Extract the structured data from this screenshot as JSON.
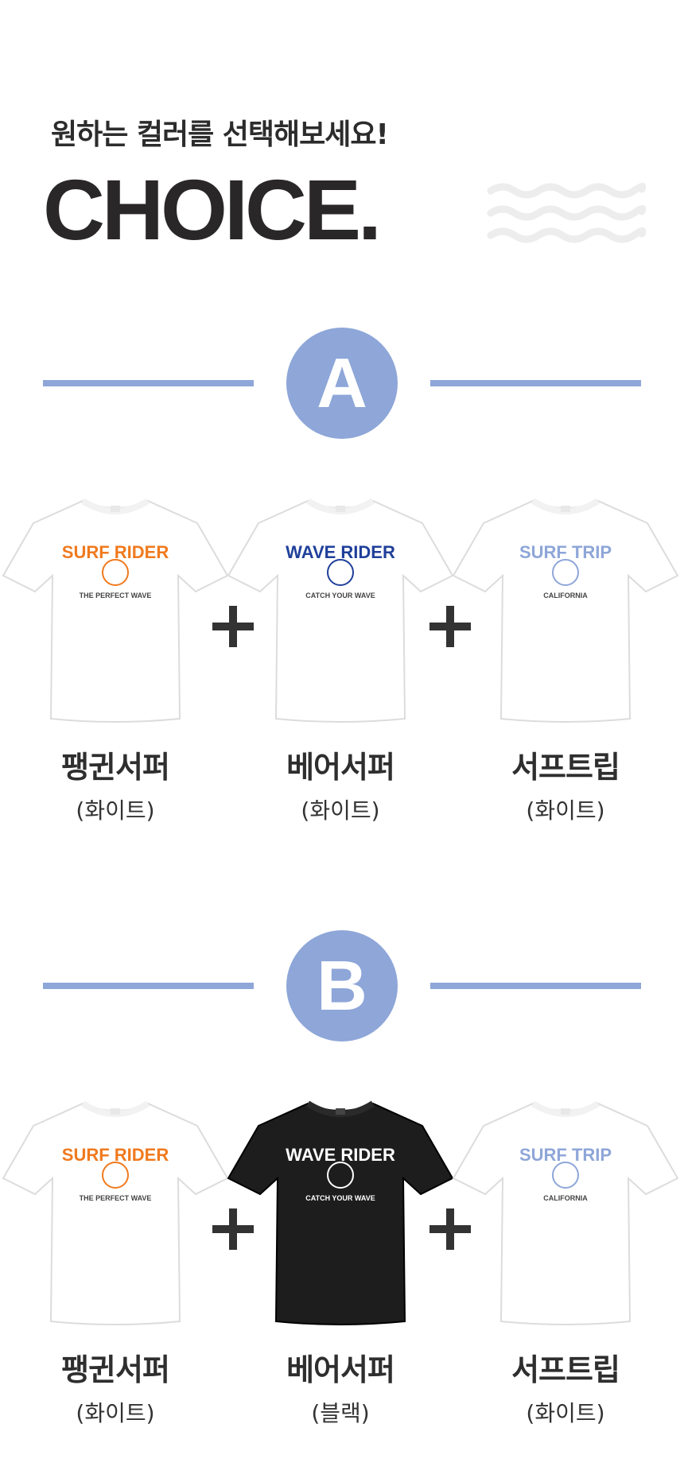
{
  "header": {
    "subtitle": "원하는 컬러를 선택해보세요!",
    "title": "CHOICE."
  },
  "accent_color": "#8ea6d8",
  "sections": [
    {
      "badge": "A",
      "items": [
        {
          "name": "팽귄서퍼",
          "color": "(화이트)",
          "shirt_color": "#ffffff",
          "print_title": "SURF RIDER",
          "print_sub": "THE PERFECT WAVE",
          "print_color": "#f07a1e"
        },
        {
          "name": "베어서퍼",
          "color": "(화이트)",
          "shirt_color": "#ffffff",
          "print_title": "WAVE RIDER",
          "print_sub": "CATCH YOUR WAVE",
          "print_color": "#1f3f9a"
        },
        {
          "name": "서프트립",
          "color": "(화이트)",
          "shirt_color": "#ffffff",
          "print_title": "SURF TRIP",
          "print_sub": "CALIFORNIA",
          "print_color": "#8ea6d8"
        }
      ]
    },
    {
      "badge": "B",
      "items": [
        {
          "name": "팽귄서퍼",
          "color": "(화이트)",
          "shirt_color": "#ffffff",
          "print_title": "SURF RIDER",
          "print_sub": "THE PERFECT WAVE",
          "print_color": "#f07a1e"
        },
        {
          "name": "베어서퍼",
          "color": "(블랙)",
          "shirt_color": "#1d1d1d",
          "print_title": "WAVE RIDER",
          "print_sub": "CATCH YOUR WAVE",
          "print_color": "#ffffff"
        },
        {
          "name": "서프트립",
          "color": "(화이트)",
          "shirt_color": "#ffffff",
          "print_title": "SURF TRIP",
          "print_sub": "CALIFORNIA",
          "print_color": "#8ea6d8"
        }
      ]
    }
  ]
}
